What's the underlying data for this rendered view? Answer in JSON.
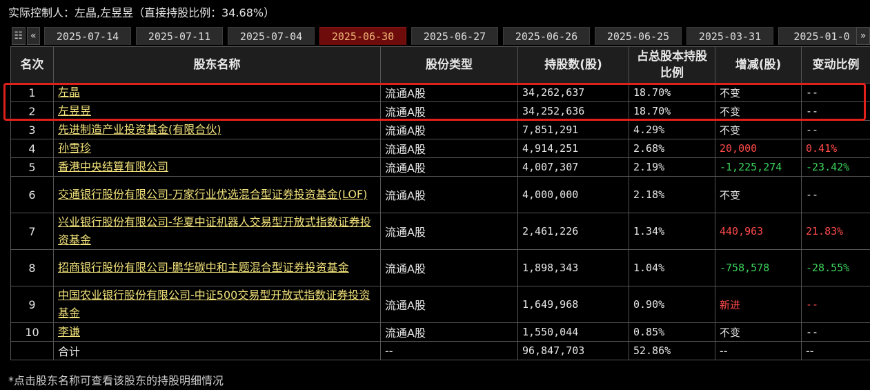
{
  "header": {
    "text": "实际控制人：左晶,左昱昱（直接持股比例：34.68%）"
  },
  "tabs": {
    "menu_glyph": "☷",
    "prev_glyph": "«",
    "next_glyph": "»",
    "dates": [
      "2025-07-14",
      "2025-07-11",
      "2025-07-04",
      "2025-06-30",
      "2025-06-27",
      "2025-06-26",
      "2025-06-25",
      "2025-03-31",
      "2025-01-0"
    ],
    "active_index": 3
  },
  "table": {
    "headers": {
      "rank": "名次",
      "name": "股东名称",
      "type": "股份类型",
      "shares": "持股数(股)",
      "pct": "占总股本持股比例",
      "change": "增减(股)",
      "ratio": "变动比例"
    },
    "rows": [
      {
        "rank": "1",
        "name": "左晶",
        "type": "流通A股",
        "shares": "34,262,637",
        "pct": "18.70%",
        "change": "不变",
        "ratio": "--"
      },
      {
        "rank": "2",
        "name": "左昱昱",
        "type": "流通A股",
        "shares": "34,252,636",
        "pct": "18.70%",
        "change": "不变",
        "ratio": "--"
      },
      {
        "rank": "3",
        "name": "先进制造产业投资基金(有限合伙)",
        "type": "流通A股",
        "shares": "7,851,291",
        "pct": "4.29%",
        "change": "不变",
        "ratio": "--"
      },
      {
        "rank": "4",
        "name": "孙雪珍",
        "type": "流通A股",
        "shares": "4,914,251",
        "pct": "2.68%",
        "change": "20,000",
        "ratio": "0.41%"
      },
      {
        "rank": "5",
        "name": "香港中央结算有限公司",
        "type": "流通A股",
        "shares": "4,007,307",
        "pct": "2.19%",
        "change": "-1,225,274",
        "ratio": "-23.42%"
      },
      {
        "rank": "6",
        "name": "交通银行股份有限公司-万家行业优选混合型证券投资基金(LOF)",
        "type": "流通A股",
        "shares": "4,000,000",
        "pct": "2.18%",
        "change": "不变",
        "ratio": "--"
      },
      {
        "rank": "7",
        "name": "兴业银行股份有限公司-华夏中证机器人交易型开放式指数证券投资基金",
        "type": "流通A股",
        "shares": "2,461,226",
        "pct": "1.34%",
        "change": "440,963",
        "ratio": "21.83%"
      },
      {
        "rank": "8",
        "name": "招商银行股份有限公司-鹏华碳中和主题混合型证券投资基金",
        "type": "流通A股",
        "shares": "1,898,343",
        "pct": "1.04%",
        "change": "-758,578",
        "ratio": "-28.55%"
      },
      {
        "rank": "9",
        "name": "中国农业银行股份有限公司-中证500交易型开放式指数证券投资基金",
        "type": "流通A股",
        "shares": "1,649,968",
        "pct": "0.90%",
        "change": "新进",
        "ratio": "--"
      },
      {
        "rank": "10",
        "name": "李谦",
        "type": "流通A股",
        "shares": "1,550,044",
        "pct": "0.85%",
        "change": "不变",
        "ratio": "--"
      }
    ],
    "total": {
      "label": "合计",
      "type": "--",
      "shares": "96,847,703",
      "pct": "52.86%",
      "change": "--",
      "ratio": "--"
    }
  },
  "footer": {
    "text": "*点击股东名称可查看该股东的持股明细情况"
  },
  "colors": {
    "increase": "#ff4a4a",
    "decrease": "#3cd65c",
    "link": "#f2e27a",
    "highlight_box": "#e0201a",
    "active_tab": "#6e0b0b"
  }
}
